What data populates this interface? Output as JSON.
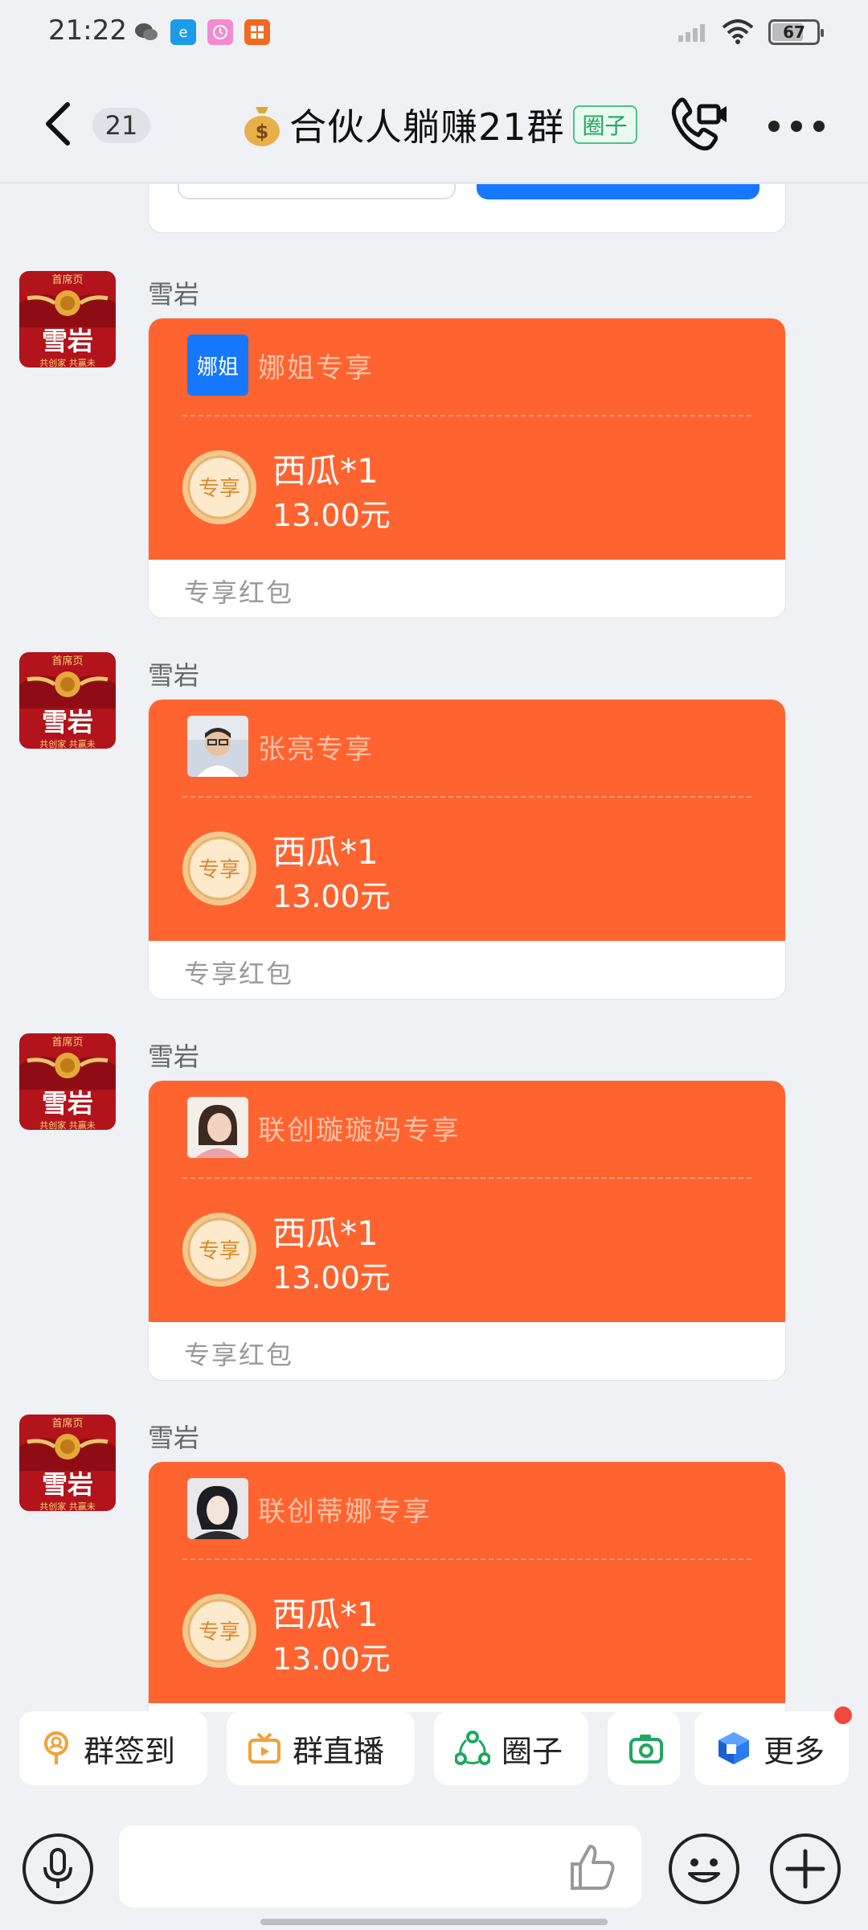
{
  "status_bar": {
    "time": "21:22",
    "battery": "67",
    "battery_level_percent": 67,
    "app_icons": [
      "wechat-icon",
      "browser-icon",
      "clock-app-icon",
      "app-grid-icon"
    ]
  },
  "header": {
    "unread_count": "21",
    "title": "合伙人躺赚21群",
    "tag": "圈子",
    "icons": [
      "back-arrow-icon",
      "money-bag-icon",
      "video-call-icon",
      "more-icon"
    ]
  },
  "messages": [
    {
      "sender": "雪岩",
      "avatar_text": {
        "top": "首席页",
        "main": "雪岩",
        "bottom": "共创家 共赢未"
      },
      "recipient": "娜姐专享",
      "recipient_avatar_text": "娜姐",
      "gift": "西瓜*1",
      "amount": "13.00元",
      "badge": "专享",
      "footer": "专享红包"
    },
    {
      "sender": "雪岩",
      "avatar_text": {
        "top": "首席页",
        "main": "雪岩",
        "bottom": "共创家 共赢未"
      },
      "recipient": "张亮专享",
      "recipient_avatar_text": "",
      "gift": "西瓜*1",
      "amount": "13.00元",
      "badge": "专享",
      "footer": "专享红包"
    },
    {
      "sender": "雪岩",
      "avatar_text": {
        "top": "首席页",
        "main": "雪岩",
        "bottom": "共创家 共赢未"
      },
      "recipient": "联创璇璇妈专享",
      "recipient_avatar_text": "",
      "gift": "西瓜*1",
      "amount": "13.00元",
      "badge": "专享",
      "footer": "专享红包"
    },
    {
      "sender": "雪岩",
      "avatar_text": {
        "top": "首席页",
        "main": "雪岩",
        "bottom": "共创家 共赢未"
      },
      "recipient": "联创蒂娜专享",
      "recipient_avatar_text": "",
      "gift": "西瓜*1",
      "amount": "13.00元",
      "badge": "专享",
      "footer": ""
    }
  ],
  "quick_actions": [
    {
      "label": "群签到",
      "icon": "checkin-icon"
    },
    {
      "label": "群直播",
      "icon": "live-tv-icon"
    },
    {
      "label": "圈子",
      "icon": "circle-icon"
    },
    {
      "label": "",
      "icon": "camera-icon"
    },
    {
      "label": "更多",
      "icon": "more-cube-icon"
    }
  ],
  "input_bar": {
    "icons": [
      "microphone-icon",
      "thumbs-up-icon",
      "emoji-icon",
      "plus-icon"
    ]
  },
  "colors": {
    "red_packet": "#ff6330",
    "accent_blue": "#1677ff",
    "tag_green": "#1fa760",
    "notify_red": "#f0483e"
  }
}
